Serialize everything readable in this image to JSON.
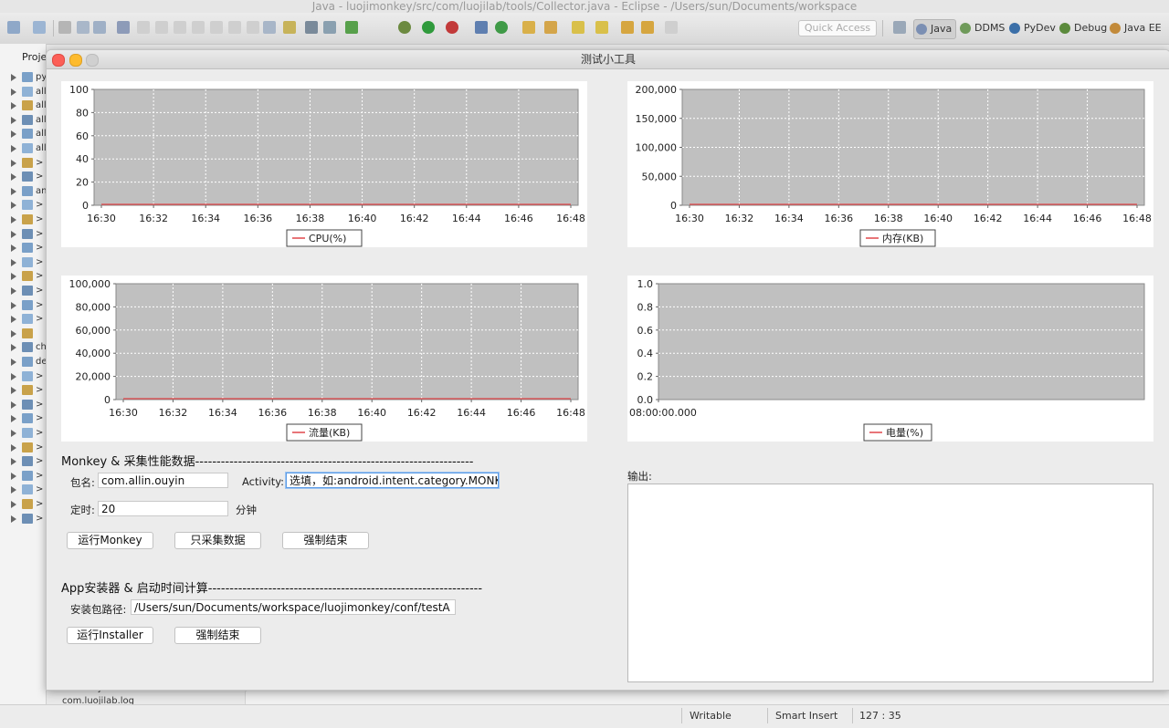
{
  "eclipse": {
    "title": "Java - luojimonkey/src/com/luojilab/tools/Collector.java - Eclipse - /Users/sun/Documents/workspace",
    "quick_access_placeholder": "Quick Access",
    "perspectives": [
      "Java",
      "DDMS",
      "PyDev",
      "Debug",
      "Java EE"
    ],
    "package_explorer": {
      "tab_label": "Proje",
      "items": [
        "py",
        "all",
        "all",
        "all",
        "all",
        "all",
        ">",
        ">",
        "an",
        ">",
        ">",
        ">",
        ">",
        ">",
        ">",
        ">",
        ">",
        ">",
        "",
        "ch",
        "de",
        ">",
        ">",
        ">",
        ">",
        ">",
        ">",
        ">",
        ">",
        ">",
        ">",
        ">"
      ],
      "bottom_items": [
        "com.luojilab.installer",
        "com.luojilab.log"
      ]
    },
    "statusbar": {
      "mode": "Writable",
      "insert": "Smart Insert",
      "position": "127 : 35"
    }
  },
  "dialog": {
    "title": "测试小工具",
    "monkey_section": {
      "title": "Monkey & 采集性能数据-----------------------------------------------------------------",
      "package_label": "包名:",
      "package_value": "com.allin.ouyin",
      "activity_label": "Activity:",
      "activity_value": "选填，如:android.intent.category.MONKEY",
      "timer_label": "定时:",
      "timer_value": "20",
      "timer_unit": "分钟",
      "run_monkey_button": "运行Monkey",
      "collect_only_button": "只采集数据",
      "force_stop_button": "强制结束"
    },
    "installer_section": {
      "title": "App安装器 & 启动时间计算----------------------------------------------------------------",
      "path_label": "安装包路径:",
      "path_value": "/Users/sun/Documents/workspace/luojimonkey/conf/testA",
      "run_installer_button": "运行Installer",
      "force_stop_button": "强制结束"
    },
    "output_label": "输出:",
    "colors": {
      "plot_bg": "#c0c0c0",
      "series_line": "#e0474a",
      "grid": "#ffffff"
    }
  },
  "chart_data": [
    {
      "type": "line",
      "x": [
        "16:30",
        "16:32",
        "16:34",
        "16:36",
        "16:38",
        "16:40",
        "16:42",
        "16:44",
        "16:46",
        "16:48"
      ],
      "series": [
        {
          "name": "CPU(%)",
          "values": [
            0,
            0,
            0,
            0,
            0,
            0,
            0,
            0,
            0,
            0
          ]
        }
      ],
      "ylim": [
        0,
        100
      ],
      "yticks": [
        "0",
        "20",
        "40",
        "60",
        "80",
        "100"
      ],
      "legend": "bottom",
      "grid": true
    },
    {
      "type": "line",
      "x": [
        "16:30",
        "16:32",
        "16:34",
        "16:36",
        "16:38",
        "16:40",
        "16:42",
        "16:44",
        "16:46",
        "16:48"
      ],
      "series": [
        {
          "name": "内存(KB)",
          "values": [
            0,
            0,
            0,
            0,
            0,
            0,
            0,
            0,
            0,
            0
          ]
        }
      ],
      "ylim": [
        0,
        200000
      ],
      "yticks": [
        "0",
        "50,000",
        "100,000",
        "150,000",
        "200,000"
      ],
      "legend": "bottom",
      "grid": true
    },
    {
      "type": "line",
      "x": [
        "16:30",
        "16:32",
        "16:34",
        "16:36",
        "16:38",
        "16:40",
        "16:42",
        "16:44",
        "16:46",
        "16:48"
      ],
      "series": [
        {
          "name": "流量(KB)",
          "values": [
            0,
            0,
            0,
            0,
            0,
            0,
            0,
            0,
            0,
            0
          ]
        }
      ],
      "ylim": [
        0,
        100000
      ],
      "yticks": [
        "0",
        "20,000",
        "40,000",
        "60,000",
        "80,000",
        "100,000"
      ],
      "legend": "bottom",
      "grid": true
    },
    {
      "type": "line",
      "x": [
        "08:00:00.000"
      ],
      "series": [
        {
          "name": "电量(%)",
          "values": []
        }
      ],
      "ylim": [
        0.0,
        1.0
      ],
      "yticks": [
        "0.0",
        "0.2",
        "0.4",
        "0.6",
        "0.8",
        "1.0"
      ],
      "legend": "bottom",
      "grid": true
    }
  ]
}
